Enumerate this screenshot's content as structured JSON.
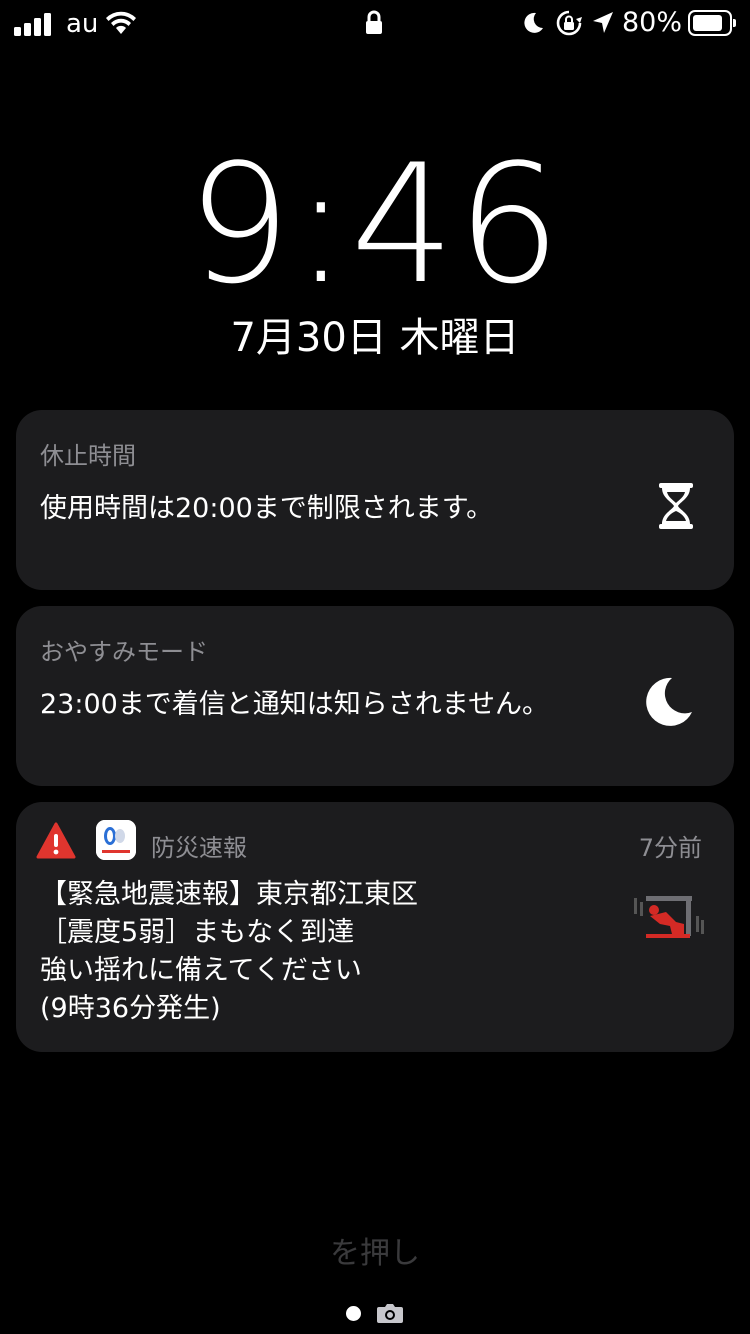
{
  "status_bar": {
    "carrier": "au",
    "battery_percent": "80%",
    "battery_level": 0.8,
    "icons": [
      "signal-icon",
      "wifi-icon",
      "lock-icon",
      "do-not-disturb-moon-icon",
      "rotation-lock-icon",
      "location-arrow-icon",
      "battery-icon"
    ]
  },
  "lock_screen": {
    "time": "9:46",
    "date": "7月30日 木曜日"
  },
  "notifications": [
    {
      "title": "休止時間",
      "body": "使用時間は20:00まで制限されます。",
      "icon": "hourglass-icon"
    },
    {
      "title": "おやすみモード",
      "body": "23:00まで着信と通知は知らされません。",
      "icon": "moon-icon"
    },
    {
      "app_name": "防災速報",
      "time_ago": "7分前",
      "lines": [
        "【緊急地震速報】東京都江東区",
        "［震度5弱］まもなく到達",
        "強い揺れに備えてください",
        "(9時36分発生)"
      ],
      "icons": [
        "warning-icon",
        "yahoo-bousai-app-icon",
        "earthquake-take-cover-icon"
      ],
      "colors": {
        "warning": "#e0352e",
        "figure": "#d42a25"
      }
    }
  ],
  "bottom": {
    "hint": "を押し",
    "icons": [
      "page-dot-icon",
      "camera-icon"
    ]
  }
}
